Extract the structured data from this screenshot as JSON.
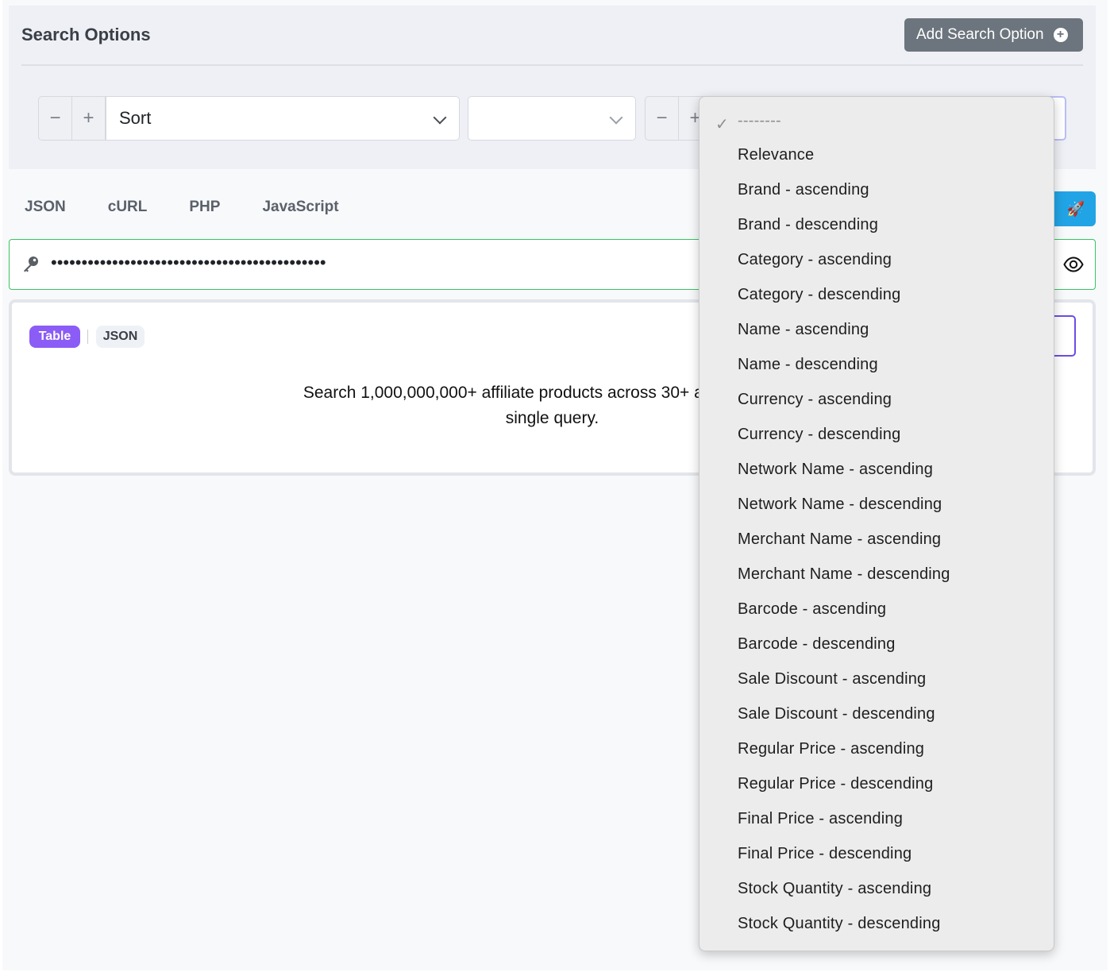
{
  "search": {
    "title": "Search Options",
    "add_button": "Add Search Option",
    "row": {
      "minus": "−",
      "plus": "+",
      "sort_value": "Sort",
      "second_value": ""
    }
  },
  "lang_tabs": [
    "JSON",
    "cURL",
    "PHP",
    "JavaScript"
  ],
  "run_icon": "🚀",
  "api_key": {
    "masked": "•••••••••••••••••••••••••••••••••••••••••••••"
  },
  "card": {
    "tab_table": "Table",
    "tab_json": "JSON",
    "line1": "Search 1,000,000,000+ affiliate products across 30+ affiliate networ",
    "line2": "single query."
  },
  "dropdown": {
    "selected": "--------",
    "options": [
      "Relevance",
      "Brand - ascending",
      "Brand - descending",
      "Category - ascending",
      "Category - descending",
      "Name - ascending",
      "Name - descending",
      "Currency - ascending",
      "Currency - descending",
      "Network Name - ascending",
      "Network Name - descending",
      "Merchant Name - ascending",
      "Merchant Name - descending",
      "Barcode - ascending",
      "Barcode - descending",
      "Sale Discount - ascending",
      "Sale Discount - descending",
      "Regular Price - ascending",
      "Regular Price - descending",
      "Final Price - ascending",
      "Final Price - descending",
      "Stock Quantity - ascending",
      "Stock Quantity - descending"
    ]
  }
}
